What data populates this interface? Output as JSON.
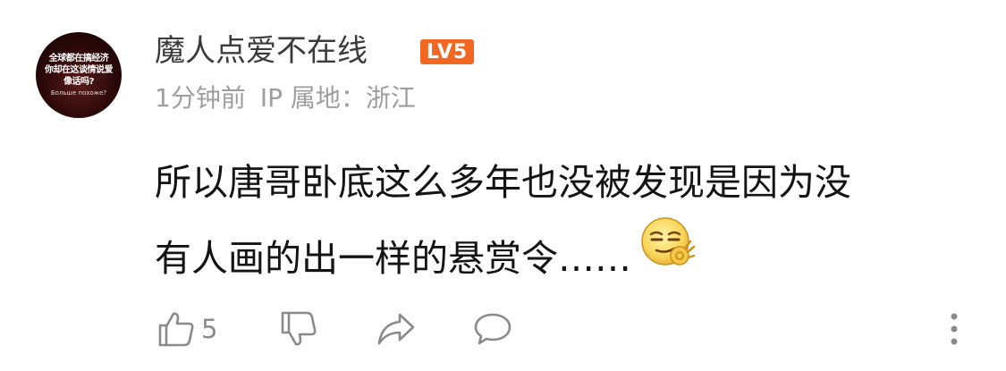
{
  "user": {
    "name": "魔人点爱不在线",
    "level": "LV5",
    "level_color": "#f26722",
    "avatar_text_lines": [
      "全球都在搞经济",
      "你却在这谈情说爱",
      "像话吗?"
    ],
    "avatar_subtext": "Больше похоже?"
  },
  "meta": {
    "time": "1分钟前",
    "ip_location": "IP 属地：浙江"
  },
  "comment": {
    "lines": [
      "所以唐哥卧底这么多年也没被发现是因为没",
      "有人画的出一样的悬赏令……"
    ],
    "emoji": "smirk-ok-hand-emoji"
  },
  "actions": {
    "like_count": "5",
    "icons": [
      "thumb-up-icon",
      "thumb-down-icon",
      "share-icon",
      "comment-icon",
      "more-icon"
    ],
    "icon_color": "#8a8a8a"
  }
}
